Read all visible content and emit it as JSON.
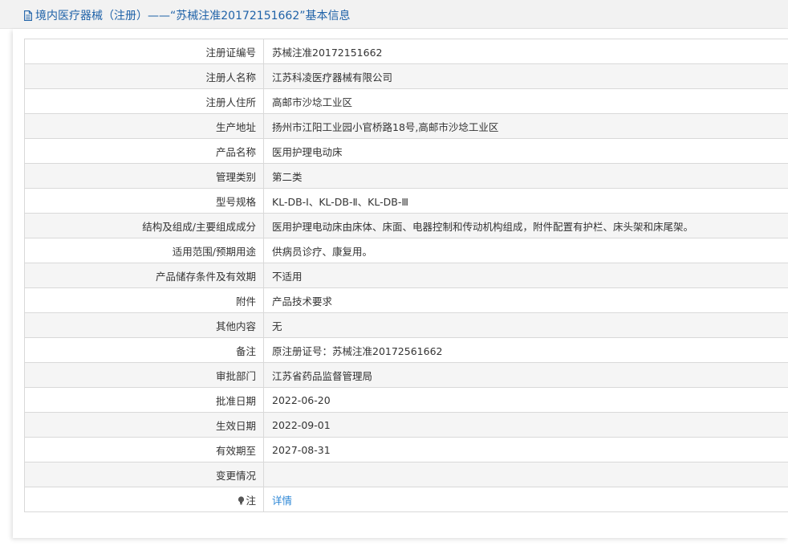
{
  "header": {
    "title": "境内医疗器械（注册）——“苏械注准20172151662”基本信息"
  },
  "rows": [
    {
      "label": "注册证编号",
      "value": "苏械注准20172151662"
    },
    {
      "label": "注册人名称",
      "value": "江苏科凌医疗器械有限公司"
    },
    {
      "label": "注册人住所",
      "value": "高邮市沙埝工业区"
    },
    {
      "label": "生产地址",
      "value": "扬州市江阳工业园小官桥路18号,高邮市沙埝工业区"
    },
    {
      "label": "产品名称",
      "value": "医用护理电动床"
    },
    {
      "label": "管理类别",
      "value": "第二类"
    },
    {
      "label": "型号规格",
      "value": "KL-DB-Ⅰ、KL-DB-Ⅱ、KL-DB-Ⅲ"
    },
    {
      "label": "结构及组成/主要组成成分",
      "value": "医用护理电动床由床体、床面、电器控制和传动机构组成，附件配置有护栏、床头架和床尾架。"
    },
    {
      "label": "适用范围/预期用途",
      "value": "供病员诊疗、康复用。"
    },
    {
      "label": "产品储存条件及有效期",
      "value": "不适用"
    },
    {
      "label": "附件",
      "value": "产品技术要求"
    },
    {
      "label": "其他内容",
      "value": "无"
    },
    {
      "label": "备注",
      "value": "原注册证号：苏械注准20172561662"
    },
    {
      "label": "审批部门",
      "value": "江苏省药品监督管理局"
    },
    {
      "label": "批准日期",
      "value": "2022-06-20"
    },
    {
      "label": "生效日期",
      "value": "2022-09-01"
    },
    {
      "label": "有效期至",
      "value": "2027-08-31"
    },
    {
      "label": "变更情况",
      "value": ""
    }
  ],
  "note_row": {
    "label": "注",
    "link_text": "详情",
    "icon": "lightbulb-icon"
  },
  "colors": {
    "title": "#1f62a8",
    "link": "#2d87d6",
    "border": "#d9d9d9",
    "stripe": "#f5f5f5",
    "header_bg": "#f2f2f2"
  }
}
